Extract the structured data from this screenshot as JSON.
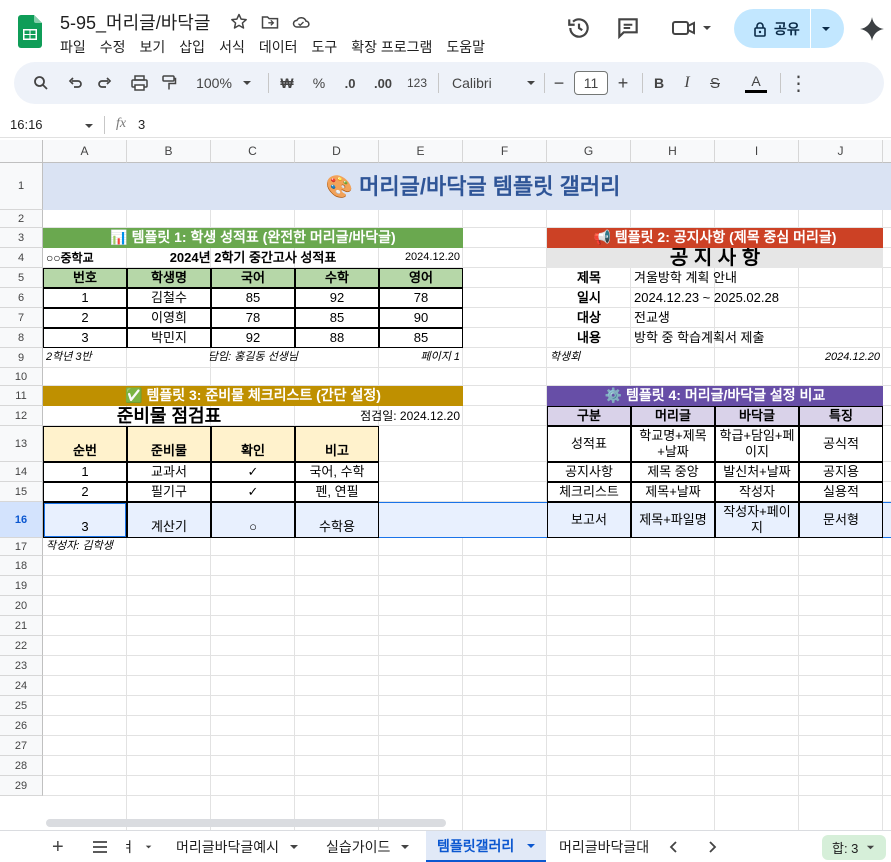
{
  "app": {
    "doc_title": "5-95_머리글/바닥글",
    "menu": [
      "파일",
      "수정",
      "보기",
      "삽입",
      "서식",
      "데이터",
      "도구",
      "확장 프로그램",
      "도움말"
    ],
    "share_label": "공유"
  },
  "toolbar": {
    "zoom": "100%",
    "currency": "₩",
    "percent": "%",
    "dec_less": ".0",
    "dec_more": ".00",
    "num_format": "123",
    "font": "Calibri",
    "font_size": "11",
    "bold": "B",
    "text_color": "A"
  },
  "formula_bar": {
    "cell_ref": "16:16",
    "fx": "fx",
    "value": "3"
  },
  "columns": [
    "A",
    "B",
    "C",
    "D",
    "E",
    "F",
    "G",
    "H",
    "I",
    "J"
  ],
  "rows": [
    "1",
    "2",
    "3",
    "4",
    "5",
    "6",
    "7",
    "8",
    "9",
    "10",
    "11",
    "12",
    "13",
    "14",
    "15",
    "16",
    "17",
    "18",
    "19",
    "20",
    "21",
    "22",
    "23",
    "24",
    "25",
    "26",
    "27",
    "28",
    "29"
  ],
  "banner": "🎨 머리글/바닥글 템플릿 갤러리",
  "t1": {
    "title": "📊 템플릿 1: 학생 성적표 (완전한 머리글/바닥글)",
    "school": "○○중학교",
    "heading": "2024년 2학기 중간고사 성적표",
    "date": "2024.12.20",
    "headers": [
      "번호",
      "학생명",
      "국어",
      "수학",
      "영어"
    ],
    "rows": [
      [
        "1",
        "김철수",
        "85",
        "92",
        "78"
      ],
      [
        "2",
        "이영희",
        "78",
        "85",
        "90"
      ],
      [
        "3",
        "박민지",
        "92",
        "88",
        "85"
      ]
    ],
    "footer_left": "2학년 3반",
    "footer_center": "담임: 홍길동 선생님",
    "footer_right": "페이지 1"
  },
  "t2": {
    "title": "📢 템플릿 2: 공지사항 (제목 중심 머리글)",
    "heading": "공 지 사 항",
    "rows": [
      [
        "제목",
        "겨울방학 계획 안내"
      ],
      [
        "일시",
        "2024.12.23 ~ 2025.02.28"
      ],
      [
        "대상",
        "전교생"
      ],
      [
        "내용",
        "방학 중 학습계획서 제출"
      ]
    ],
    "footer_left": "학생회",
    "footer_right": "2024.12.20"
  },
  "t3": {
    "title": "✅ 템플릿 3: 준비물 체크리스트 (간단 설정)",
    "heading": "준비물 점검표",
    "date": "점검일: 2024.12.20",
    "headers": [
      "순번",
      "준비물",
      "확인",
      "비고"
    ],
    "rows": [
      [
        "1",
        "교과서",
        "✓",
        "국어, 수학"
      ],
      [
        "2",
        "필기구",
        "✓",
        "펜, 연필"
      ],
      [
        "3",
        "계산기",
        "○",
        "수학용"
      ]
    ],
    "footer": "작성자: 김학생"
  },
  "t4": {
    "title": "⚙️ 템플릿 4: 머리글/바닥글 설정 비교",
    "headers": [
      "구분",
      "머리글",
      "바닥글",
      "특징"
    ],
    "rows": [
      [
        "성적표",
        "학교명+제목+날짜",
        "학급+담임+페이지",
        "공식적"
      ],
      [
        "공지사항",
        "제목 중앙",
        "발신처+날짜",
        "공지용"
      ],
      [
        "체크리스트",
        "제목+날짜",
        "작성자",
        "실용적"
      ],
      [
        "보고서",
        "제목+파일명",
        "작성자+페이지",
        "문서형"
      ]
    ]
  },
  "sheet_tabs": [
    "ㅕ",
    "머리글바닥글예시",
    "실습가이드",
    "템플릿갤러리",
    "머리글바닥글대"
  ],
  "sum_label": "합: 3",
  "colors": {
    "t1": "#6aa84f",
    "t1_header": "#b6d7a8",
    "t2": "#cc4125",
    "t2_bar": "#e6e6e6",
    "t3": "#bf9000",
    "t3_header": "#fff2cc",
    "t4": "#674ea7",
    "t4_header": "#d9d2e9",
    "banner_bg": "#dae3f3",
    "banner_text": "#2f5597",
    "selection": "#e8f0fe"
  }
}
